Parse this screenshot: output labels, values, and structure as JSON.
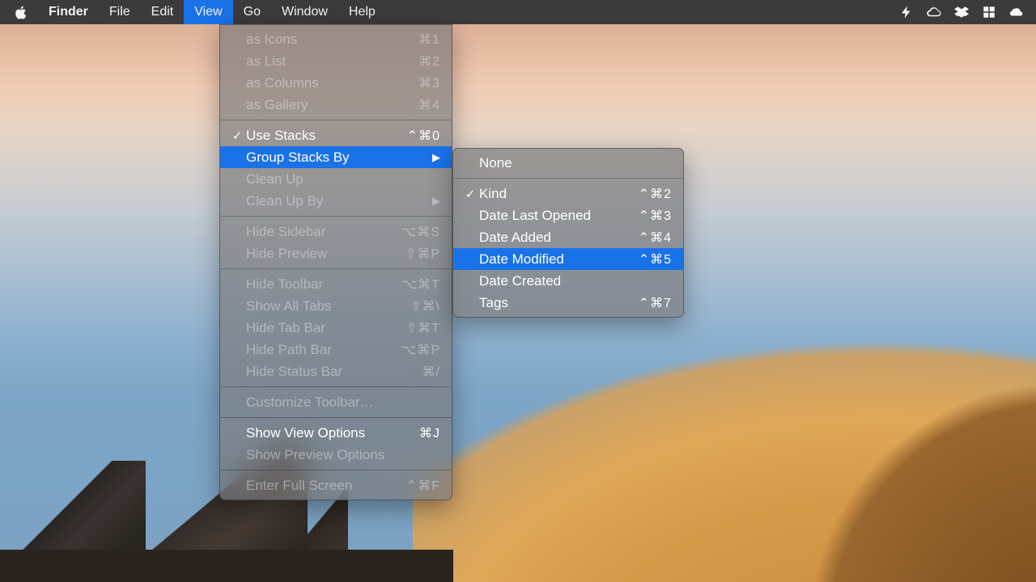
{
  "menubar": {
    "app": "Finder",
    "items": [
      "File",
      "Edit",
      "View",
      "Go",
      "Window",
      "Help"
    ],
    "active": "View",
    "status_icons": [
      "bolt-icon",
      "creative-cloud-icon",
      "dropbox-icon",
      "grid-icon",
      "onedrive-icon"
    ]
  },
  "view_menu": {
    "groups": [
      [
        {
          "label": "as Icons",
          "shortcut": "⌘1",
          "enabled": false
        },
        {
          "label": "as List",
          "shortcut": "⌘2",
          "enabled": false
        },
        {
          "label": "as Columns",
          "shortcut": "⌘3",
          "enabled": false
        },
        {
          "label": "as Gallery",
          "shortcut": "⌘4",
          "enabled": false
        }
      ],
      [
        {
          "label": "Use Stacks",
          "shortcut": "⌃⌘0",
          "enabled": true,
          "checked": true
        },
        {
          "label": "Group Stacks By",
          "submenu": true,
          "enabled": true,
          "highlight": true
        },
        {
          "label": "Clean Up",
          "enabled": false
        },
        {
          "label": "Clean Up By",
          "submenu": true,
          "enabled": false
        }
      ],
      [
        {
          "label": "Hide Sidebar",
          "shortcut": "⌥⌘S",
          "enabled": false
        },
        {
          "label": "Hide Preview",
          "shortcut": "⇧⌘P",
          "enabled": false
        }
      ],
      [
        {
          "label": "Hide Toolbar",
          "shortcut": "⌥⌘T",
          "enabled": false
        },
        {
          "label": "Show All Tabs",
          "shortcut": "⇧⌘\\",
          "enabled": false
        },
        {
          "label": "Hide Tab Bar",
          "shortcut": "⇧⌘T",
          "enabled": false
        },
        {
          "label": "Hide Path Bar",
          "shortcut": "⌥⌘P",
          "enabled": false
        },
        {
          "label": "Hide Status Bar",
          "shortcut": "⌘/",
          "enabled": false
        }
      ],
      [
        {
          "label": "Customize Toolbar…",
          "enabled": false
        }
      ],
      [
        {
          "label": "Show View Options",
          "shortcut": "⌘J",
          "enabled": true
        },
        {
          "label": "Show Preview Options",
          "enabled": false
        }
      ],
      [
        {
          "label": "Enter Full Screen",
          "shortcut": "⌃⌘F",
          "enabled": false
        }
      ]
    ]
  },
  "group_submenu": {
    "groups": [
      [
        {
          "label": "None",
          "enabled": true
        }
      ],
      [
        {
          "label": "Kind",
          "shortcut": "⌃⌘2",
          "enabled": true,
          "checked": true
        },
        {
          "label": "Date Last Opened",
          "shortcut": "⌃⌘3",
          "enabled": true
        },
        {
          "label": "Date Added",
          "shortcut": "⌃⌘4",
          "enabled": true
        },
        {
          "label": "Date Modified",
          "shortcut": "⌃⌘5",
          "enabled": true,
          "highlight": true
        },
        {
          "label": "Date Created",
          "enabled": true
        },
        {
          "label": "Tags",
          "shortcut": "⌃⌘7",
          "enabled": true
        }
      ]
    ]
  }
}
